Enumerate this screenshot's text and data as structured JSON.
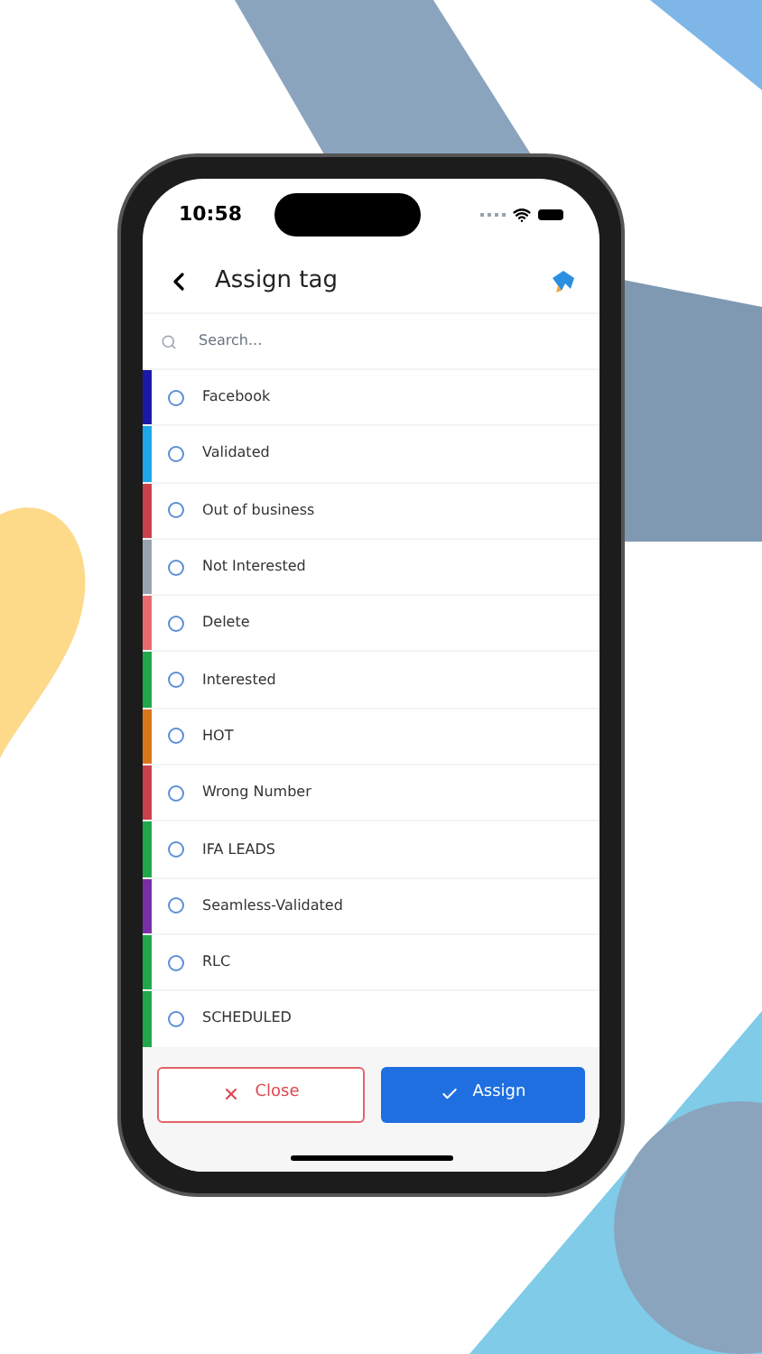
{
  "status_bar": {
    "time": "10:58"
  },
  "header": {
    "title": "Assign tag"
  },
  "search": {
    "placeholder": "Search..."
  },
  "tags": [
    {
      "label": "Facebook",
      "color": "#1a1aa6",
      "selected": false
    },
    {
      "label": "Validated",
      "color": "#1ea7e8",
      "selected": false
    },
    {
      "label": "Out of business",
      "color": "#c9414a",
      "selected": false
    },
    {
      "label": "Not Interested",
      "color": "#9aa3b0",
      "selected": false
    },
    {
      "label": "Delete",
      "color": "#e86a6f",
      "selected": false
    },
    {
      "label": "Interested",
      "color": "#22a84a",
      "selected": false
    },
    {
      "label": "HOT",
      "color": "#d9761c",
      "selected": false
    },
    {
      "label": "Wrong Number",
      "color": "#c9414a",
      "selected": false
    },
    {
      "label": "IFA LEADS",
      "color": "#22a84a",
      "selected": false
    },
    {
      "label": "Seamless-Validated",
      "color": "#7a2ea6",
      "selected": false
    },
    {
      "label": "RLC",
      "color": "#22a84a",
      "selected": false
    },
    {
      "label": "SCHEDULED",
      "color": "#22a84a",
      "selected": false
    }
  ],
  "buttons": [
    {
      "kind": "close",
      "label": "Close"
    },
    {
      "kind": "assign",
      "label": "Assign"
    }
  ]
}
